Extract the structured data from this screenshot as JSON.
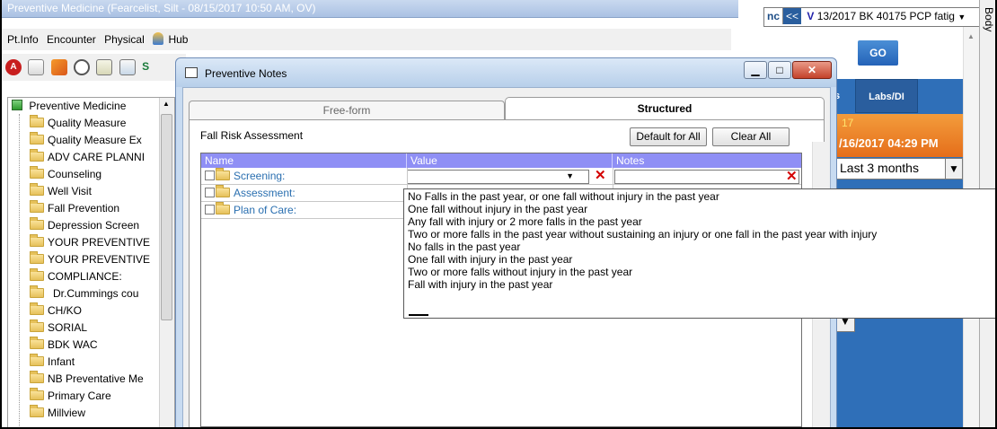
{
  "app": {
    "window_title": "Preventive Medicine (Fearcelist, Silt - 08/15/2017 10:50 AM, OV)"
  },
  "menu": {
    "items": [
      "Pt.Info",
      "Encounter",
      "Physical",
      "Hub"
    ]
  },
  "toolbar": {
    "icons": [
      "alert-icon",
      "copy-icon",
      "edit-icon",
      "user-icon",
      "list-icon",
      "chart-icon"
    ],
    "trailing_text": "S"
  },
  "tree": {
    "root": "Preventive Medicine",
    "items": [
      "Quality Measure",
      "Quality Measure Ex",
      "ADV CARE PLANNI",
      "Counseling",
      "Well Visit",
      "Fall Prevention",
      "Depression Screen",
      "YOUR PREVENTIVE",
      "YOUR PREVENTIVE",
      "COMPLIANCE:",
      "Dr.Cummings cou",
      "CH/KO",
      "SORIAL",
      "BDK WAC",
      "Infant",
      "NB Preventative Me",
      "Primary Care",
      "Millview"
    ]
  },
  "right_panel": {
    "nav_prefix": "nc",
    "nav_back": "<<",
    "visit_selector": "13/2017 BK 40175 PCP fatig",
    "go_label": "GO",
    "tab_left": "s",
    "tab_labs": "Labs/DI",
    "year_fragment": "17",
    "date_text": "/16/2017 04:29 PM",
    "range_select": "Last 3 months",
    "far_right_label": "Body"
  },
  "dialog": {
    "title": "Preventive Notes",
    "tab_freeform": "Free-form",
    "tab_structured": "Structured",
    "section_label": "Fall Risk Assessment",
    "default_button": "Default for All",
    "clear_button": "Clear All",
    "columns": [
      "Name",
      "Value",
      "Notes"
    ],
    "rows": [
      {
        "name": "Screening:"
      },
      {
        "name": "Assessment:"
      },
      {
        "name": "Plan of Care:"
      }
    ],
    "dropdown_options": [
      "No Falls in the past year, or one fall without injury in the past year",
      "One fall without injury in the past year",
      "Any fall with injury or 2 more falls in the past year",
      "Two or more falls in the past year without sustaining an injury or one fall in the past year with injury",
      "No falls in the past year",
      "One fall with injury in the past year",
      "Two or more falls without injury in the past year",
      "Fall with injury in the past year"
    ]
  }
}
